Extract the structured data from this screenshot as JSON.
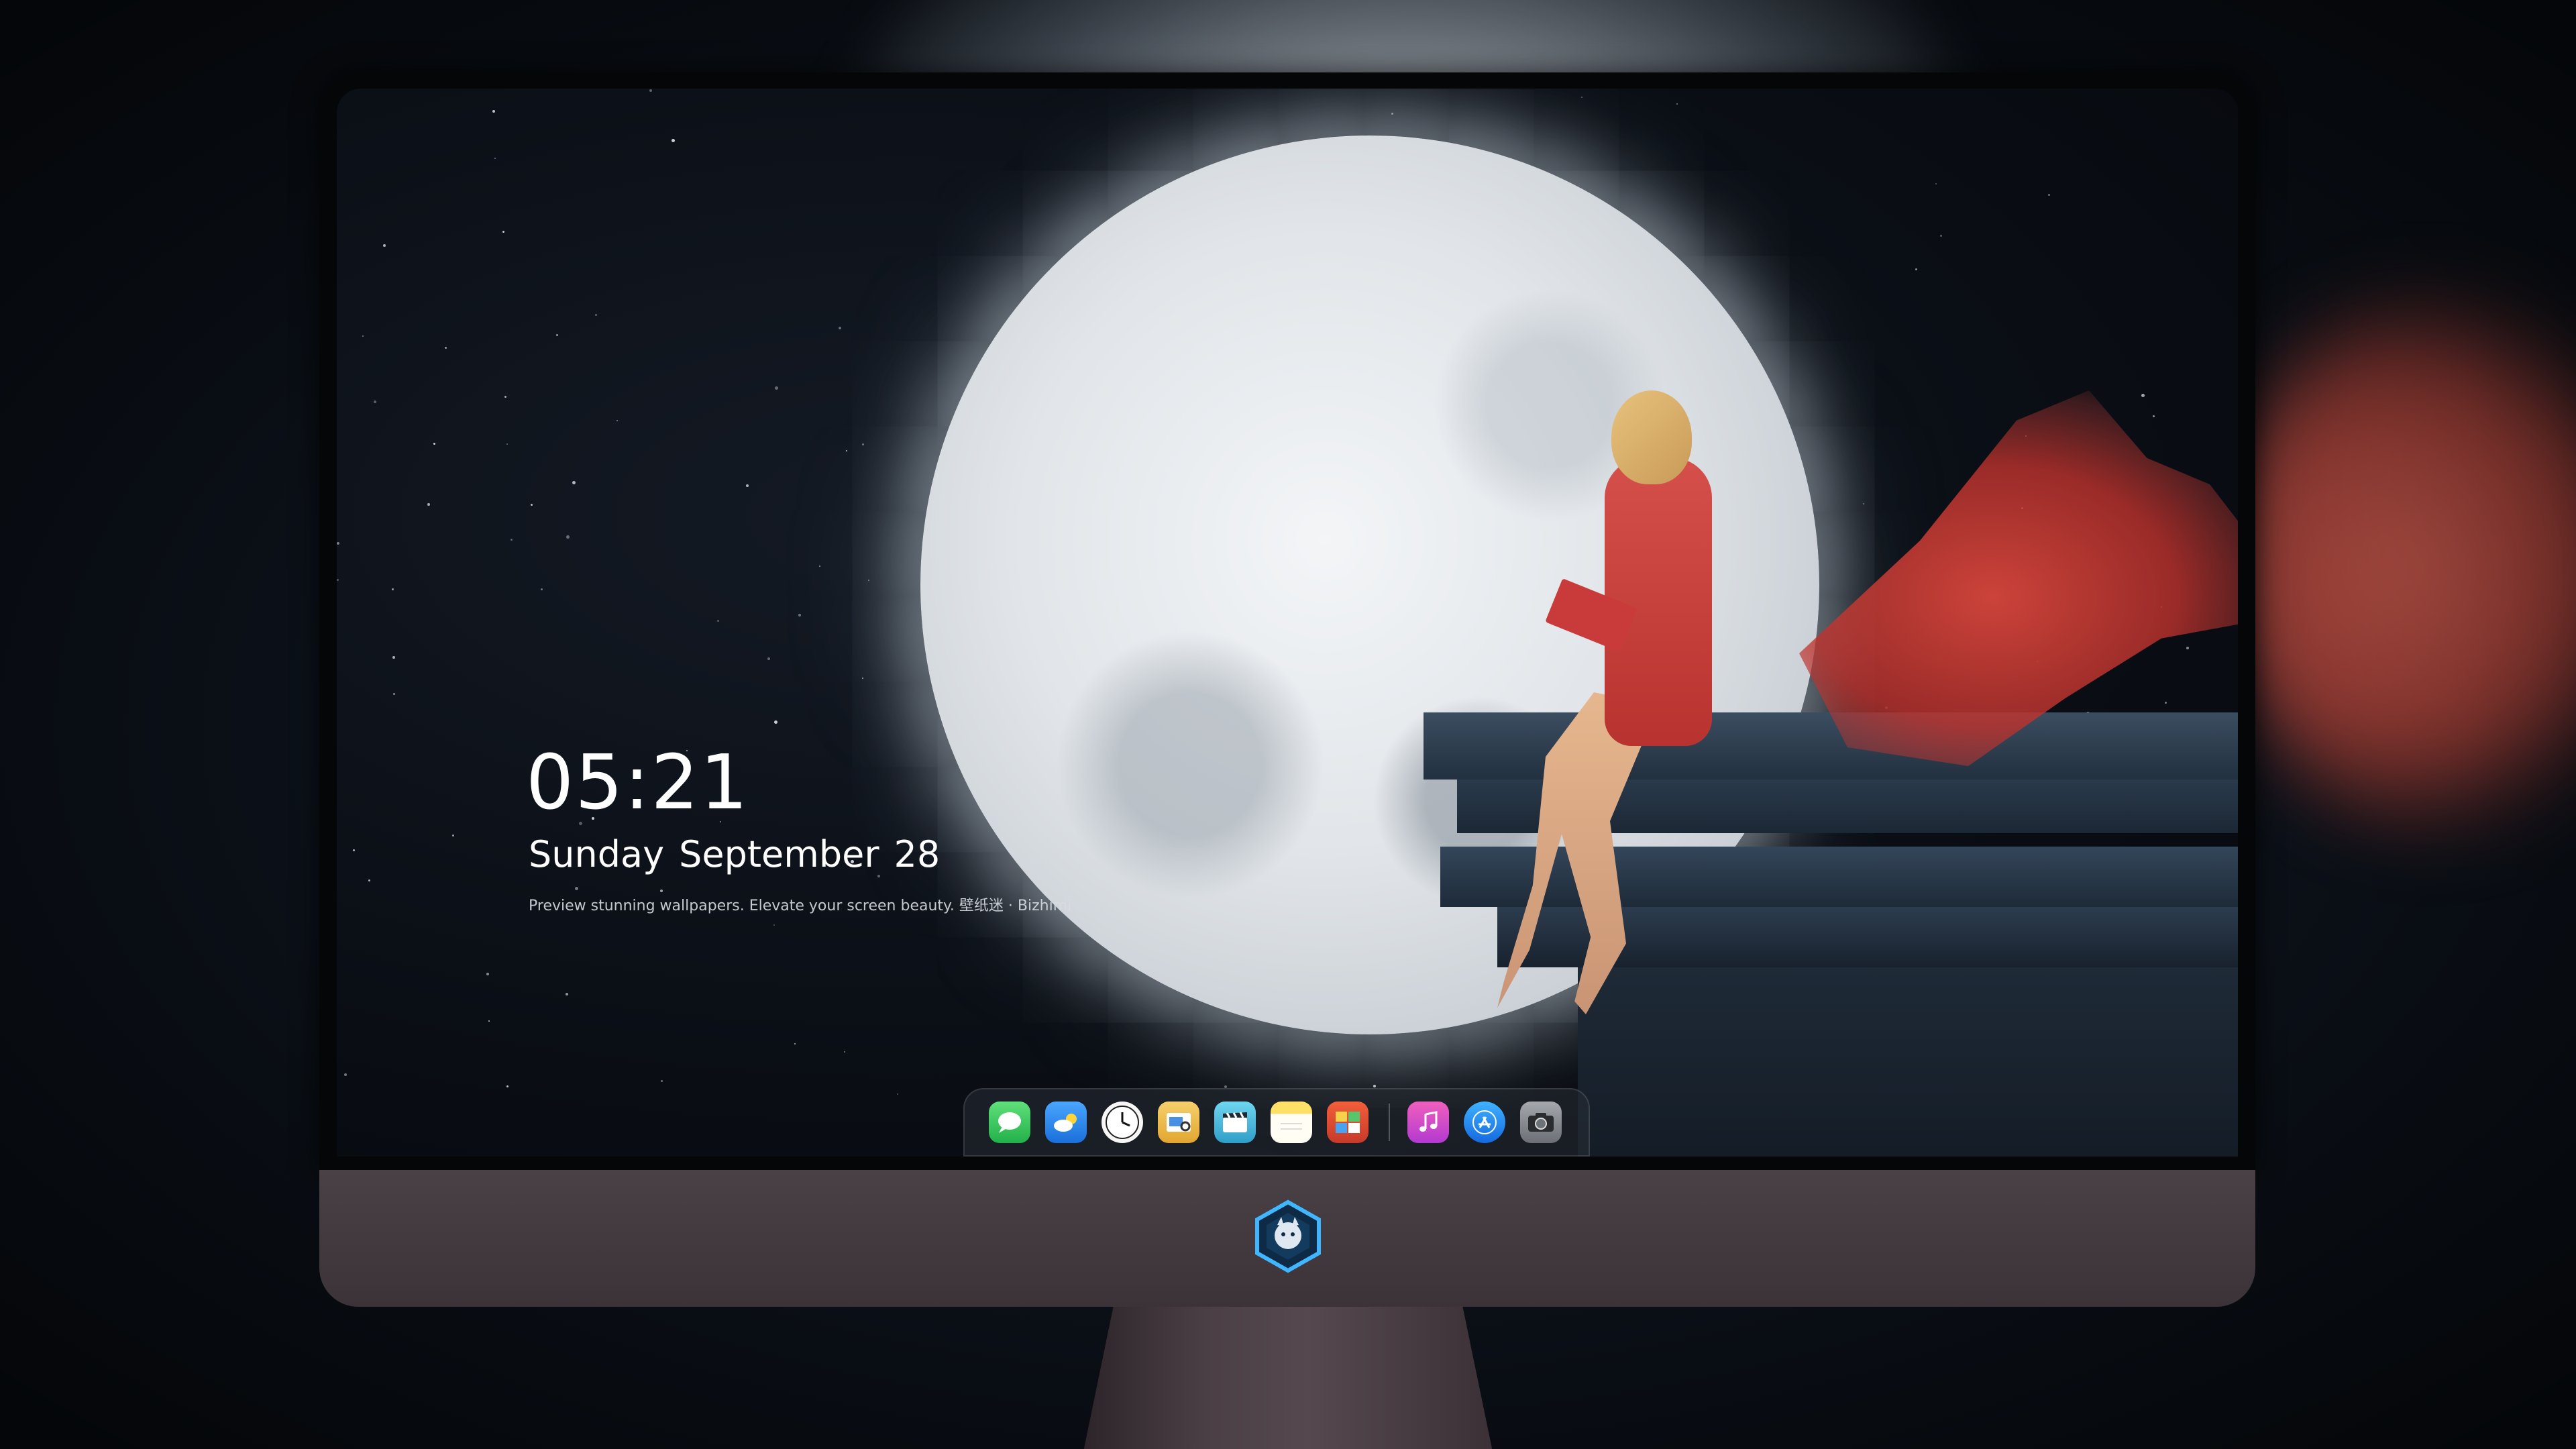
{
  "lockscreen": {
    "time": "05:21",
    "weekday": "Sunday",
    "month": "September",
    "day": "28",
    "tagline": "Preview stunning wallpapers. Elevate your screen beauty. 壁纸迷 · Bizhimi"
  },
  "dock": {
    "apps": [
      {
        "name": "messages-icon",
        "color": "#34c759"
      },
      {
        "name": "weather-icon",
        "color": "#2f8cf0"
      },
      {
        "name": "clock-icon",
        "color": "#f2f2f2"
      },
      {
        "name": "preview-icon",
        "color": "#e9b23a"
      },
      {
        "name": "clips-icon",
        "color": "#45b6d8"
      },
      {
        "name": "notes-icon",
        "color": "#ffd43b"
      },
      {
        "name": "photo-booth-icon",
        "color": "#e85a3b"
      },
      {
        "name": "music-icon",
        "color": "#d83a8c"
      },
      {
        "name": "app-store-icon",
        "color": "#1e7bf2"
      },
      {
        "name": "camera-icon",
        "color": "#8c8f95"
      }
    ]
  },
  "colors": {
    "dress_red": "#d5504a",
    "moon_white": "#e8ecef",
    "night_sky": "#0a0e15",
    "monitor_chin": "#433a3f"
  }
}
